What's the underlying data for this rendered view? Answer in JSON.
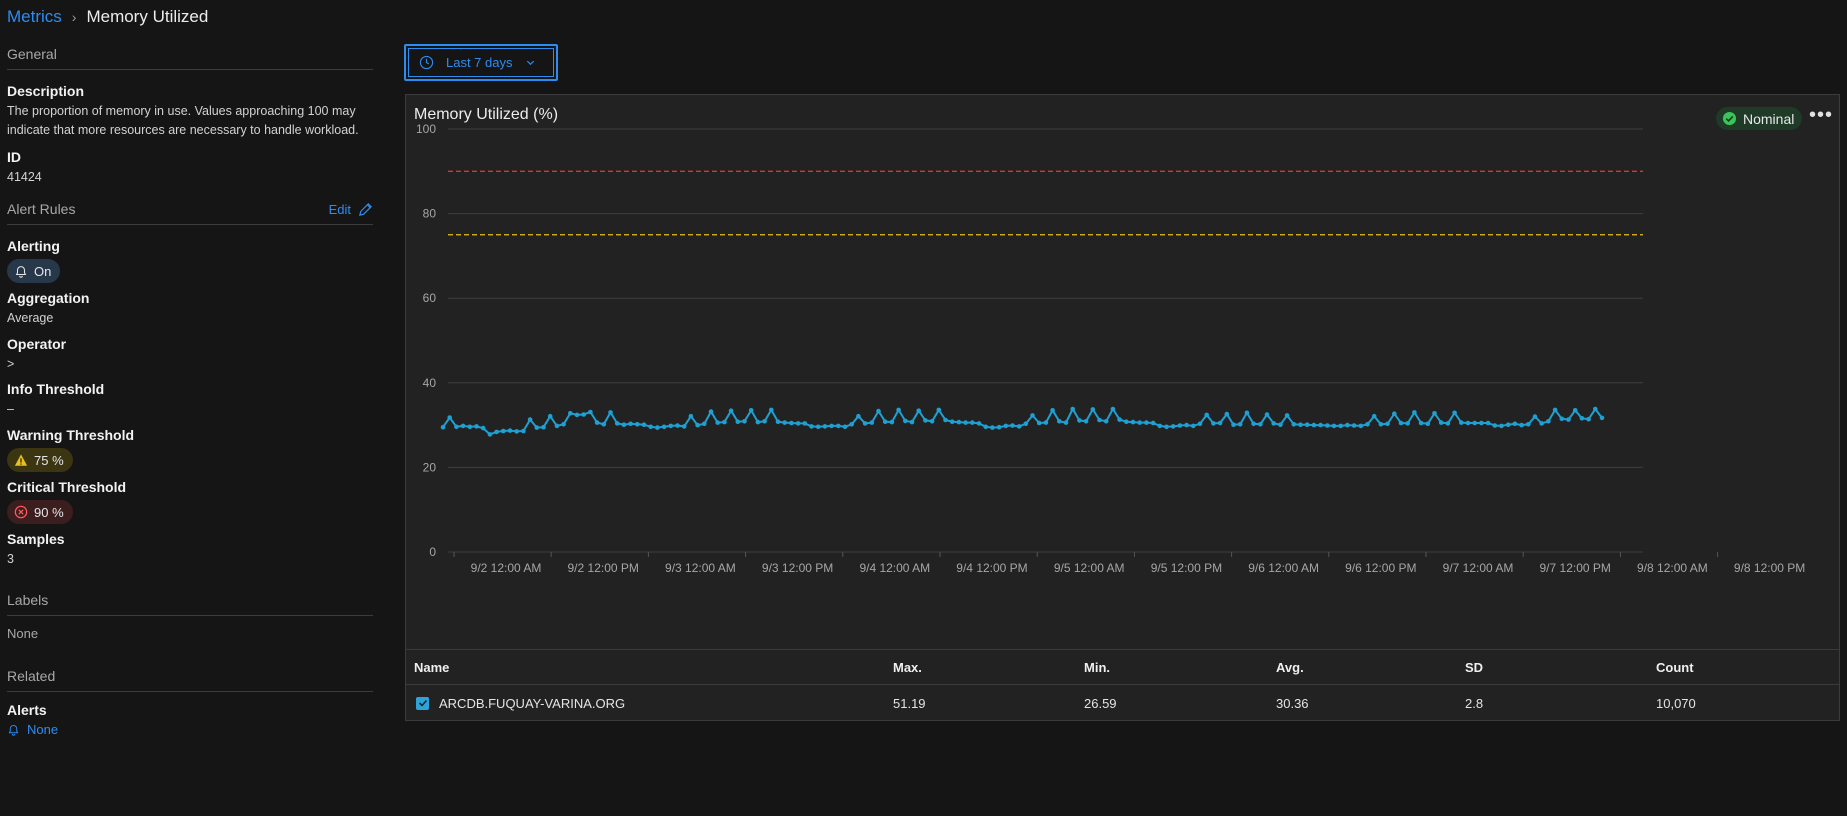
{
  "breadcrumb": {
    "parent": "Metrics",
    "separator": "›",
    "current": "Memory Utilized"
  },
  "sidebar": {
    "general_title": "General",
    "description_label": "Description",
    "description_value": "The proportion of memory in use. Values approaching 100 may indicate that more resources are necessary to handle workload.",
    "id_label": "ID",
    "id_value": "41424",
    "alert_rules_title": "Alert Rules",
    "edit_label": "Edit",
    "alerting_label": "Alerting",
    "alerting_value": "On",
    "aggregation_label": "Aggregation",
    "aggregation_value": "Average",
    "operator_label": "Operator",
    "operator_value": ">",
    "info_threshold_label": "Info Threshold",
    "info_threshold_value": "–",
    "warning_threshold_label": "Warning Threshold",
    "warning_threshold_value": "75 %",
    "critical_threshold_label": "Critical Threshold",
    "critical_threshold_value": "90 %",
    "samples_label": "Samples",
    "samples_value": "3",
    "labels_title": "Labels",
    "labels_value": "None",
    "related_title": "Related",
    "alerts_label": "Alerts",
    "alerts_value": "None"
  },
  "time_range": {
    "label": "Last 7 days"
  },
  "card": {
    "title": "Memory Utilized (%)",
    "status": "Nominal"
  },
  "colors": {
    "accent": "#2d8cf0",
    "series": "#1fa0d2",
    "warning": "#e6c01c",
    "critical": "#e0323a",
    "nominal": "#3ac45a"
  },
  "chart_data": {
    "type": "line",
    "title": "Memory Utilized (%)",
    "ylim": [
      0,
      100
    ],
    "yticks": [
      0,
      20,
      40,
      60,
      80,
      100
    ],
    "xtick_labels": [
      "9/2 12:00 AM",
      "9/2 12:00 PM",
      "9/3 12:00 AM",
      "9/3 12:00 PM",
      "9/4 12:00 AM",
      "9/4 12:00 PM",
      "9/5 12:00 AM",
      "9/5 12:00 PM",
      "9/6 12:00 AM",
      "9/6 12:00 PM",
      "9/7 12:00 AM",
      "9/7 12:00 PM",
      "9/8 12:00 AM",
      "9/8 12:00 PM"
    ],
    "thresholds": [
      {
        "name": "Critical",
        "value": 90,
        "color": "#e0323a"
      },
      {
        "name": "Warning",
        "value": 75,
        "color": "#e6c01c"
      }
    ],
    "series": [
      {
        "name": "ARCDB.FUQUAY-VARINA.ORG",
        "values": [
          29.5,
          31.8,
          29.6,
          29.8,
          29.6,
          29.7,
          29.3,
          27.8,
          28.4,
          28.6,
          28.7,
          28.5,
          28.6,
          31.3,
          29.4,
          29.5,
          32.1,
          29.8,
          30.2,
          32.8,
          32.4,
          32.5,
          33.1,
          30.6,
          30.2,
          33.0,
          30.4,
          30.1,
          30.3,
          30.2,
          30.1,
          29.6,
          29.4,
          29.6,
          29.8,
          29.9,
          29.7,
          32.1,
          30.0,
          30.3,
          33.2,
          30.6,
          30.7,
          33.4,
          30.8,
          30.9,
          33.5,
          30.7,
          30.9,
          33.6,
          30.8,
          30.6,
          30.5,
          30.4,
          30.4,
          29.7,
          29.6,
          29.7,
          29.8,
          29.8,
          29.6,
          30.2,
          32.1,
          30.4,
          30.6,
          33.3,
          30.8,
          30.7,
          33.6,
          31.0,
          30.7,
          33.4,
          31.1,
          30.9,
          33.6,
          31.2,
          30.8,
          30.7,
          30.6,
          30.6,
          30.4,
          29.6,
          29.4,
          29.5,
          29.8,
          29.9,
          29.7,
          30.3,
          32.3,
          30.5,
          30.6,
          33.5,
          30.9,
          30.6,
          33.8,
          31.1,
          30.9,
          33.7,
          31.2,
          30.9,
          33.8,
          31.3,
          30.8,
          30.7,
          30.6,
          30.6,
          30.5,
          29.8,
          29.6,
          29.7,
          29.9,
          30.0,
          29.8,
          30.3,
          32.4,
          30.4,
          30.5,
          32.6,
          30.1,
          30.2,
          32.9,
          30.3,
          30.2,
          32.5,
          30.4,
          30.1,
          32.3,
          30.2,
          30.1,
          30.1,
          30.0,
          30.0,
          29.9,
          29.8,
          29.8,
          30.0,
          29.9,
          29.8,
          30.2,
          32.1,
          30.2,
          30.3,
          32.7,
          30.5,
          30.4,
          33.0,
          30.5,
          30.3,
          32.8,
          30.6,
          30.4,
          32.9,
          30.6,
          30.5,
          30.5,
          30.5,
          30.5,
          29.9,
          29.8,
          30.1,
          30.3,
          30.0,
          30.2,
          32.0,
          30.4,
          30.9,
          33.6,
          31.5,
          31.3,
          33.5,
          31.6,
          31.4,
          33.8,
          31.7
        ]
      }
    ]
  },
  "table": {
    "headers": {
      "name": "Name",
      "max": "Max.",
      "min": "Min.",
      "avg": "Avg.",
      "sd": "SD",
      "count": "Count"
    },
    "rows": [
      {
        "name": "ARCDB.FUQUAY-VARINA.ORG",
        "max": "51.19",
        "min": "26.59",
        "avg": "30.36",
        "sd": "2.8",
        "count": "10,070"
      }
    ]
  }
}
